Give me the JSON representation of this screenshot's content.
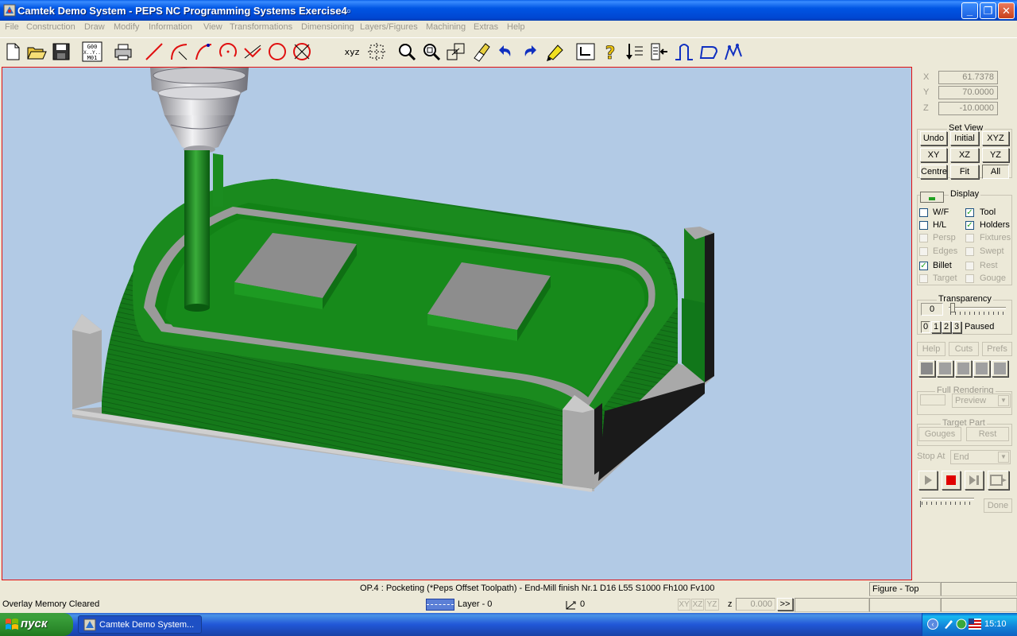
{
  "window": {
    "title": "Camtek Demo System - PEPS NC Programming Systems Exercise4▫"
  },
  "menu": [
    "File",
    "Construction",
    "Draw",
    "Modify",
    "Information",
    "View",
    "Transformations",
    "Dimensioning",
    "Layers/Figures",
    "Machining",
    "Extras",
    "Help"
  ],
  "toolbar": {
    "icons": [
      "new-file-icon",
      "open-folder-icon",
      "save-icon",
      "g00-xyz-icon",
      "print-icon",
      "line-icon",
      "arc-icon",
      "arc-tangent-icon",
      "circle-point-icon",
      "intersection-icon",
      "circle-icon",
      "delete-circle-icon",
      "xyz-icon",
      "grid-point-icon",
      "zoom-icon",
      "zoom-window-icon",
      "zoom-all-icon",
      "erase-icon",
      "undo-icon",
      "redo-icon",
      "highlighter-icon",
      "layer-icon",
      "help-question-icon",
      "sort-icon",
      "list-icon",
      "profile-icon",
      "contour-icon",
      "toolpath-icon"
    ],
    "xyz_label": "xyz",
    "g00_label": "G00\nX..Y..\nM01"
  },
  "coords": {
    "x_label": "X",
    "x_value": "61.7378",
    "y_label": "Y",
    "y_value": "70.0000",
    "z_label": "Z",
    "z_value": "-10.0000"
  },
  "set_view": {
    "title": "Set View",
    "buttons": [
      "Undo",
      "Initial",
      "XYZ",
      "XY",
      "XZ",
      "YZ",
      "Centre",
      "Fit",
      "All"
    ]
  },
  "display": {
    "title": "Display",
    "options": [
      {
        "label": "W/F",
        "checked": false,
        "enabled": true
      },
      {
        "label": "Tool",
        "checked": true,
        "enabled": true
      },
      {
        "label": "H/L",
        "checked": false,
        "enabled": true
      },
      {
        "label": "Holders",
        "checked": true,
        "enabled": true
      },
      {
        "label": "Persp",
        "checked": false,
        "enabled": false
      },
      {
        "label": "Fixtures",
        "checked": false,
        "enabled": false
      },
      {
        "label": "Edges",
        "checked": false,
        "enabled": false
      },
      {
        "label": "Swept",
        "checked": false,
        "enabled": false
      },
      {
        "label": "Billet",
        "checked": true,
        "enabled": true
      },
      {
        "label": "Rest",
        "checked": false,
        "enabled": false
      },
      {
        "label": "Target",
        "checked": false,
        "enabled": false
      },
      {
        "label": "Gouge",
        "checked": false,
        "enabled": false
      }
    ]
  },
  "transparency": {
    "title": "Transparency",
    "value": "0",
    "levels": [
      "0",
      "1",
      "2",
      "3"
    ],
    "status": "Paused"
  },
  "tabs": [
    "Help",
    "Cuts",
    "Prefs"
  ],
  "full_rendering": {
    "title": "Full Rendering",
    "mode": "Preview"
  },
  "target_part": {
    "title": "Target Part",
    "gouges": "Gouges",
    "rest": "Rest"
  },
  "stop_at": {
    "label": "Stop At",
    "value": "End"
  },
  "done_label": "Done",
  "status": {
    "operation": "OP.4 : Pocketing (*Peps Offset Toolpath)   -   End-Mill finish  Nr.1  D16  L55    S1000 Fh100 Fv100",
    "view": "Figure - Top",
    "message": "Overlay Memory Cleared",
    "layer": "Layer - 0",
    "link": "0",
    "plane_xy": "XY",
    "plane_xz": "XZ",
    "plane_yz": "YZ",
    "z_label": "z",
    "z_value": "0.000",
    "more": ">>"
  },
  "taskbar": {
    "start": "пуск",
    "task": "Camtek Demo System...",
    "clock": "15:10"
  },
  "colors": {
    "viewport_bg": "#b2cae5",
    "billet_green": "#16801a",
    "fixture_grey": "#a8a8a8",
    "titlebar_blue": "#0055e3"
  }
}
